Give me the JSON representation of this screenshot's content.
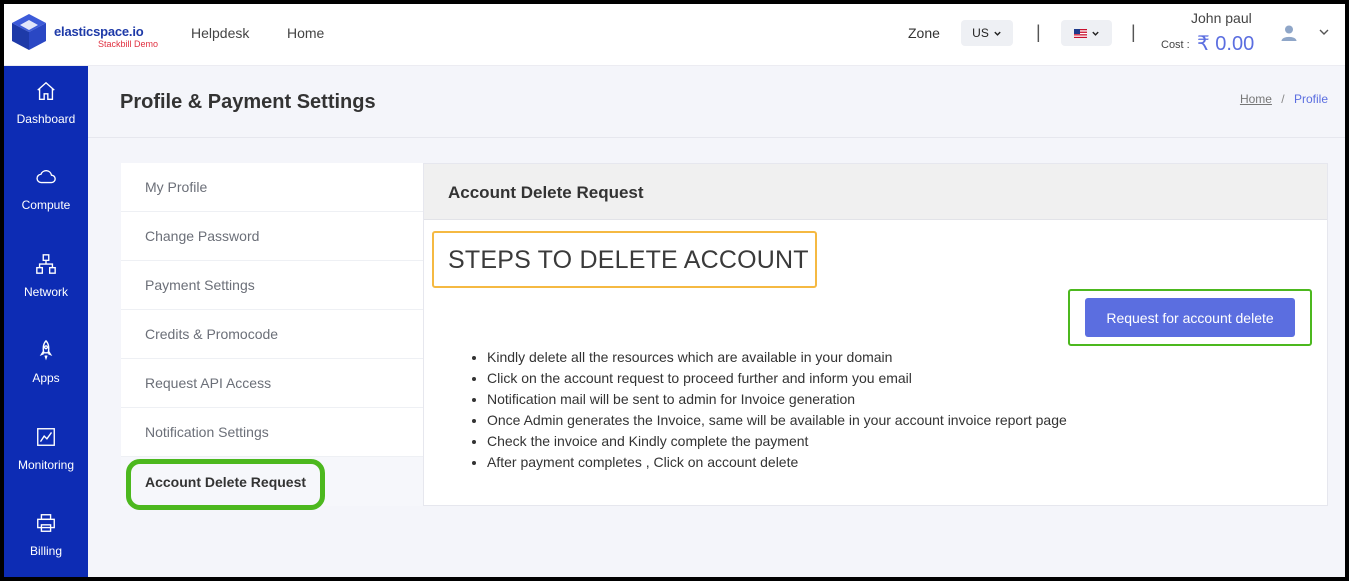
{
  "header": {
    "brand_name": "elasticspace.io",
    "brand_sub": "Stackbill Demo",
    "nav": [
      "Helpdesk",
      "Home"
    ],
    "zone_label": "Zone",
    "zone_value": "US",
    "language": "us-flag",
    "separator": "|",
    "user_name": "John paul",
    "cost_label": "Cost :",
    "cost_value": "₹ 0.00"
  },
  "sidebar": {
    "items": [
      {
        "label": "Dashboard",
        "icon": "home-icon"
      },
      {
        "label": "Compute",
        "icon": "cloud-icon"
      },
      {
        "label": "Network",
        "icon": "network-icon"
      },
      {
        "label": "Apps",
        "icon": "rocket-icon"
      },
      {
        "label": "Monitoring",
        "icon": "chart-icon"
      },
      {
        "label": "Billing",
        "icon": "printer-icon"
      }
    ]
  },
  "page": {
    "title": "Profile & Payment Settings",
    "breadcrumb": {
      "home": "Home",
      "separator": "/",
      "current": "Profile"
    }
  },
  "menu": {
    "items": [
      "My Profile",
      "Change Password",
      "Payment Settings",
      "Credits & Promocode",
      "Request API Access",
      "Notification Settings",
      "Account Delete Request"
    ],
    "active_index": 6
  },
  "panel": {
    "title": "Account Delete Request",
    "steps_heading": "STEPS TO DELETE ACCOUNT",
    "button_label": "Request for account delete",
    "steps": [
      "Kindly delete all the resources which are available in your domain",
      "Click on the account request to proceed further and inform you email",
      "Notification mail will be sent to admin for Invoice generation",
      "Once Admin generates the Invoice, same will be available in your account invoice report page",
      "Check the invoice and Kindly complete the payment",
      "After payment completes , Click on account delete"
    ]
  },
  "colors": {
    "sidebar": "#0d2cb4",
    "accent": "#5b6ee0",
    "highlight_green": "#4cb81e",
    "highlight_orange": "#f5b942"
  }
}
